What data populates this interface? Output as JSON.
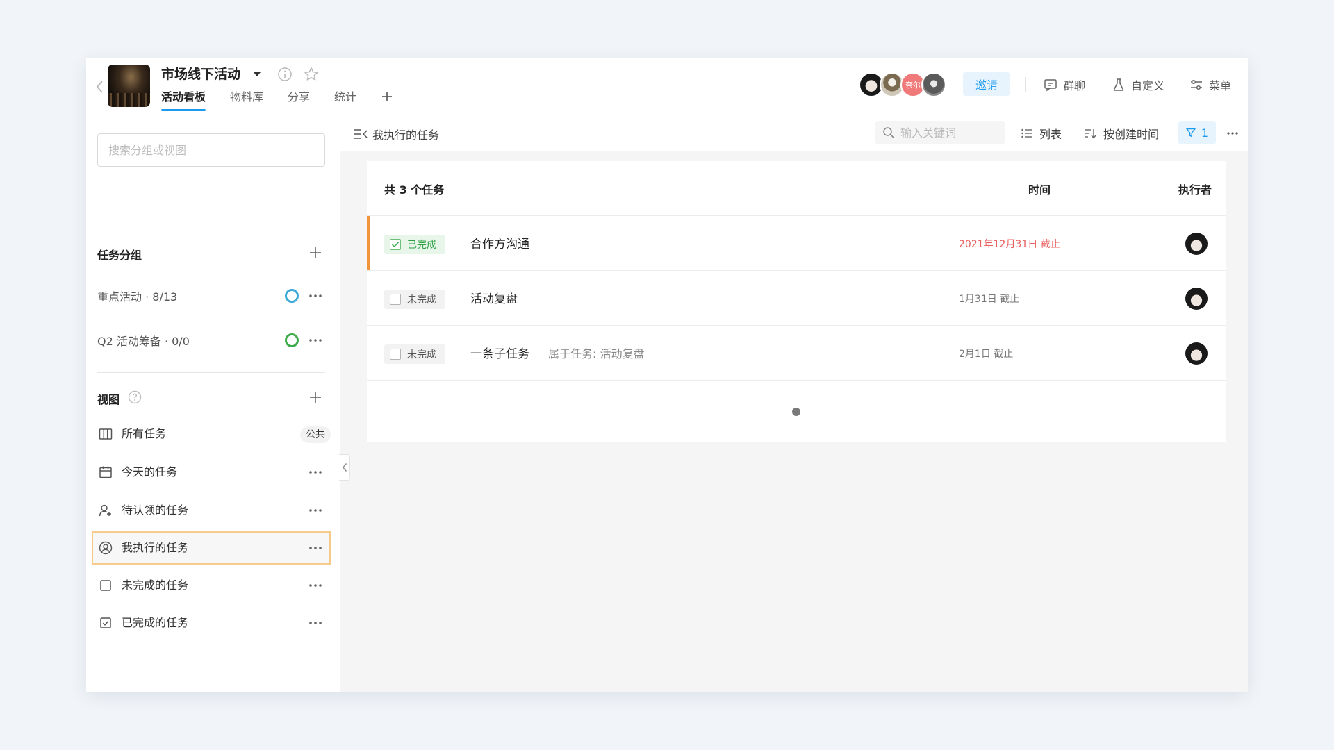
{
  "header": {
    "project_title": "市场线下活动",
    "tabs": [
      {
        "label": "活动看板",
        "active": true
      },
      {
        "label": "物料库"
      },
      {
        "label": "分享"
      },
      {
        "label": "统计"
      }
    ],
    "members": [
      {
        "icon": "avatar-photo"
      },
      {
        "icon": "avatar-photo"
      },
      {
        "label": "奈尔",
        "color": "#f07a7a"
      },
      {
        "icon": "avatar-photo"
      }
    ],
    "invite_label": "邀请",
    "group_chat_label": "群聊",
    "customize_label": "自定义",
    "menu_label": "菜单"
  },
  "sidebar": {
    "search_placeholder": "搜索分组或视图",
    "groups_title": "任务分组",
    "groups": [
      {
        "label": "重点活动 · 8/13",
        "ring_color": "#3fa9d6"
      },
      {
        "label": "Q2 活动筹备 · 0/0",
        "ring_color": "#3eab4d"
      }
    ],
    "views_title": "视图",
    "views": [
      {
        "label": "所有任务",
        "icon": "columns-icon",
        "badge": "公共"
      },
      {
        "label": "今天的任务",
        "icon": "calendar-icon"
      },
      {
        "label": "待认领的任务",
        "icon": "user-plus-icon"
      },
      {
        "label": "我执行的任务",
        "icon": "user-circle-icon",
        "active": true
      },
      {
        "label": "未完成的任务",
        "icon": "checkbox-icon"
      },
      {
        "label": "已完成的任务",
        "icon": "checkbox-checked-icon"
      }
    ]
  },
  "toolbar": {
    "view_title": "我执行的任务",
    "search_placeholder": "输入关键词",
    "list_label": "列表",
    "sort_label": "按创建时间",
    "filter_count": "1"
  },
  "table": {
    "count_label": "共 3 个任务",
    "col_time": "时间",
    "col_executor": "执行者",
    "rows": [
      {
        "status": "已完成",
        "done": true,
        "title": "合作方沟通",
        "parent": "",
        "due": "2021年12月31日 截止",
        "overdue": true,
        "highlight": true
      },
      {
        "status": "未完成",
        "done": false,
        "title": "活动复盘",
        "parent": "",
        "due": "1月31日 截止",
        "overdue": false
      },
      {
        "status": "未完成",
        "done": false,
        "title": "一条子任务",
        "parent": "属于任务: 活动复盘",
        "due": "2月1日 截止",
        "overdue": false
      }
    ]
  },
  "colors": {
    "accent": "#1b9aee",
    "highlight_bar": "#f0953a",
    "overdue": "#e86060",
    "done_green": "#2ea043"
  }
}
